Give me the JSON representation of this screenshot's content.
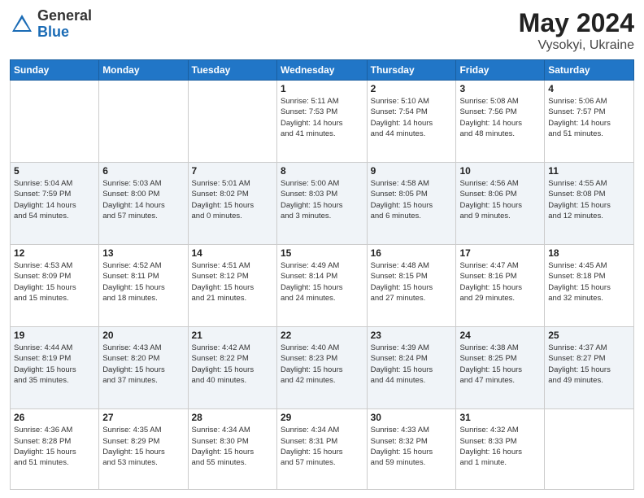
{
  "header": {
    "logo_general": "General",
    "logo_blue": "Blue",
    "title": "May 2024",
    "location": "Vysokyi, Ukraine"
  },
  "weekdays": [
    "Sunday",
    "Monday",
    "Tuesday",
    "Wednesday",
    "Thursday",
    "Friday",
    "Saturday"
  ],
  "weeks": [
    [
      {
        "day": "",
        "info": ""
      },
      {
        "day": "",
        "info": ""
      },
      {
        "day": "",
        "info": ""
      },
      {
        "day": "1",
        "info": "Sunrise: 5:11 AM\nSunset: 7:53 PM\nDaylight: 14 hours\nand 41 minutes."
      },
      {
        "day": "2",
        "info": "Sunrise: 5:10 AM\nSunset: 7:54 PM\nDaylight: 14 hours\nand 44 minutes."
      },
      {
        "day": "3",
        "info": "Sunrise: 5:08 AM\nSunset: 7:56 PM\nDaylight: 14 hours\nand 48 minutes."
      },
      {
        "day": "4",
        "info": "Sunrise: 5:06 AM\nSunset: 7:57 PM\nDaylight: 14 hours\nand 51 minutes."
      }
    ],
    [
      {
        "day": "5",
        "info": "Sunrise: 5:04 AM\nSunset: 7:59 PM\nDaylight: 14 hours\nand 54 minutes."
      },
      {
        "day": "6",
        "info": "Sunrise: 5:03 AM\nSunset: 8:00 PM\nDaylight: 14 hours\nand 57 minutes."
      },
      {
        "day": "7",
        "info": "Sunrise: 5:01 AM\nSunset: 8:02 PM\nDaylight: 15 hours\nand 0 minutes."
      },
      {
        "day": "8",
        "info": "Sunrise: 5:00 AM\nSunset: 8:03 PM\nDaylight: 15 hours\nand 3 minutes."
      },
      {
        "day": "9",
        "info": "Sunrise: 4:58 AM\nSunset: 8:05 PM\nDaylight: 15 hours\nand 6 minutes."
      },
      {
        "day": "10",
        "info": "Sunrise: 4:56 AM\nSunset: 8:06 PM\nDaylight: 15 hours\nand 9 minutes."
      },
      {
        "day": "11",
        "info": "Sunrise: 4:55 AM\nSunset: 8:08 PM\nDaylight: 15 hours\nand 12 minutes."
      }
    ],
    [
      {
        "day": "12",
        "info": "Sunrise: 4:53 AM\nSunset: 8:09 PM\nDaylight: 15 hours\nand 15 minutes."
      },
      {
        "day": "13",
        "info": "Sunrise: 4:52 AM\nSunset: 8:11 PM\nDaylight: 15 hours\nand 18 minutes."
      },
      {
        "day": "14",
        "info": "Sunrise: 4:51 AM\nSunset: 8:12 PM\nDaylight: 15 hours\nand 21 minutes."
      },
      {
        "day": "15",
        "info": "Sunrise: 4:49 AM\nSunset: 8:14 PM\nDaylight: 15 hours\nand 24 minutes."
      },
      {
        "day": "16",
        "info": "Sunrise: 4:48 AM\nSunset: 8:15 PM\nDaylight: 15 hours\nand 27 minutes."
      },
      {
        "day": "17",
        "info": "Sunrise: 4:47 AM\nSunset: 8:16 PM\nDaylight: 15 hours\nand 29 minutes."
      },
      {
        "day": "18",
        "info": "Sunrise: 4:45 AM\nSunset: 8:18 PM\nDaylight: 15 hours\nand 32 minutes."
      }
    ],
    [
      {
        "day": "19",
        "info": "Sunrise: 4:44 AM\nSunset: 8:19 PM\nDaylight: 15 hours\nand 35 minutes."
      },
      {
        "day": "20",
        "info": "Sunrise: 4:43 AM\nSunset: 8:20 PM\nDaylight: 15 hours\nand 37 minutes."
      },
      {
        "day": "21",
        "info": "Sunrise: 4:42 AM\nSunset: 8:22 PM\nDaylight: 15 hours\nand 40 minutes."
      },
      {
        "day": "22",
        "info": "Sunrise: 4:40 AM\nSunset: 8:23 PM\nDaylight: 15 hours\nand 42 minutes."
      },
      {
        "day": "23",
        "info": "Sunrise: 4:39 AM\nSunset: 8:24 PM\nDaylight: 15 hours\nand 44 minutes."
      },
      {
        "day": "24",
        "info": "Sunrise: 4:38 AM\nSunset: 8:25 PM\nDaylight: 15 hours\nand 47 minutes."
      },
      {
        "day": "25",
        "info": "Sunrise: 4:37 AM\nSunset: 8:27 PM\nDaylight: 15 hours\nand 49 minutes."
      }
    ],
    [
      {
        "day": "26",
        "info": "Sunrise: 4:36 AM\nSunset: 8:28 PM\nDaylight: 15 hours\nand 51 minutes."
      },
      {
        "day": "27",
        "info": "Sunrise: 4:35 AM\nSunset: 8:29 PM\nDaylight: 15 hours\nand 53 minutes."
      },
      {
        "day": "28",
        "info": "Sunrise: 4:34 AM\nSunset: 8:30 PM\nDaylight: 15 hours\nand 55 minutes."
      },
      {
        "day": "29",
        "info": "Sunrise: 4:34 AM\nSunset: 8:31 PM\nDaylight: 15 hours\nand 57 minutes."
      },
      {
        "day": "30",
        "info": "Sunrise: 4:33 AM\nSunset: 8:32 PM\nDaylight: 15 hours\nand 59 minutes."
      },
      {
        "day": "31",
        "info": "Sunrise: 4:32 AM\nSunset: 8:33 PM\nDaylight: 16 hours\nand 1 minute."
      },
      {
        "day": "",
        "info": ""
      }
    ]
  ]
}
